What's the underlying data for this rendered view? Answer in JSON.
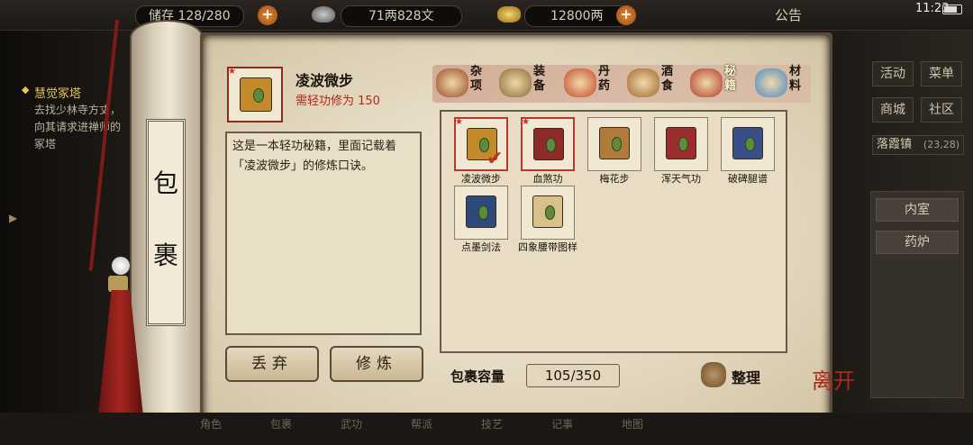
{
  "topbar": {
    "resource1": "储存 128/280",
    "resource2": "71两828文",
    "resource3": "12800两",
    "notice": "公告",
    "time": "11:23"
  },
  "quest": {
    "title": "慧觉冢塔",
    "desc": "去找少林寺方丈，向其请求进禅师的冢塔"
  },
  "right_panel": {
    "buttons": [
      "活动",
      "菜单",
      "商城",
      "社区"
    ],
    "town": "落霞镇",
    "town_coords": "(23,28)",
    "rooms": [
      "内室",
      "药炉"
    ]
  },
  "scroll": {
    "char1": "包",
    "char2": "裹"
  },
  "item": {
    "name": "凌波微步",
    "requirement": "需轻功修为 150",
    "description": "这是一本轻功秘籍，里面记载着「凌波微步」的修炼口诀。",
    "discard_label": "丢弃",
    "practice_label": "修炼"
  },
  "tabs": [
    {
      "label": "杂项",
      "icon": "jar-icon",
      "color": "#9b4a2a",
      "active": false
    },
    {
      "label": "装备",
      "icon": "weapon-icon",
      "color": "#8a6a3a",
      "active": false
    },
    {
      "label": "丹药",
      "icon": "pill-icon",
      "color": "#c44a2a",
      "active": false
    },
    {
      "label": "酒食",
      "icon": "food-icon",
      "color": "#a0682e",
      "active": false
    },
    {
      "label": "秘籍",
      "icon": "book-icon",
      "color": "#b23a2e",
      "active": true
    },
    {
      "label": "材料",
      "icon": "crystal-icon",
      "color": "#4a8ac4",
      "active": false
    }
  ],
  "items": [
    {
      "name": "凌波微步",
      "color": "#c28a2a",
      "selected": true,
      "starred": true
    },
    {
      "name": "血煞功",
      "color": "#8e2a2a",
      "selected": false,
      "starred": true
    },
    {
      "name": "梅花步",
      "color": "#b07a3a",
      "selected": false,
      "starred": false
    },
    {
      "name": "浑天气功",
      "color": "#9a2e2e",
      "selected": false,
      "starred": false
    },
    {
      "name": "破碑腿谱",
      "color": "#3a4e8a",
      "selected": false,
      "starred": false
    },
    {
      "name": "点墨剑法",
      "color": "#2e4a7a",
      "selected": false,
      "starred": false
    },
    {
      "name": "四象腰带图样",
      "color": "#d7c08a",
      "selected": false,
      "starred": false
    }
  ],
  "capacity": {
    "label": "包裹容量",
    "value": "105/350"
  },
  "sort_label": "整理",
  "close": "离开",
  "bottom_nav": [
    "角色",
    "包裹",
    "武功",
    "帮派",
    "技艺",
    "记事",
    "地图"
  ]
}
